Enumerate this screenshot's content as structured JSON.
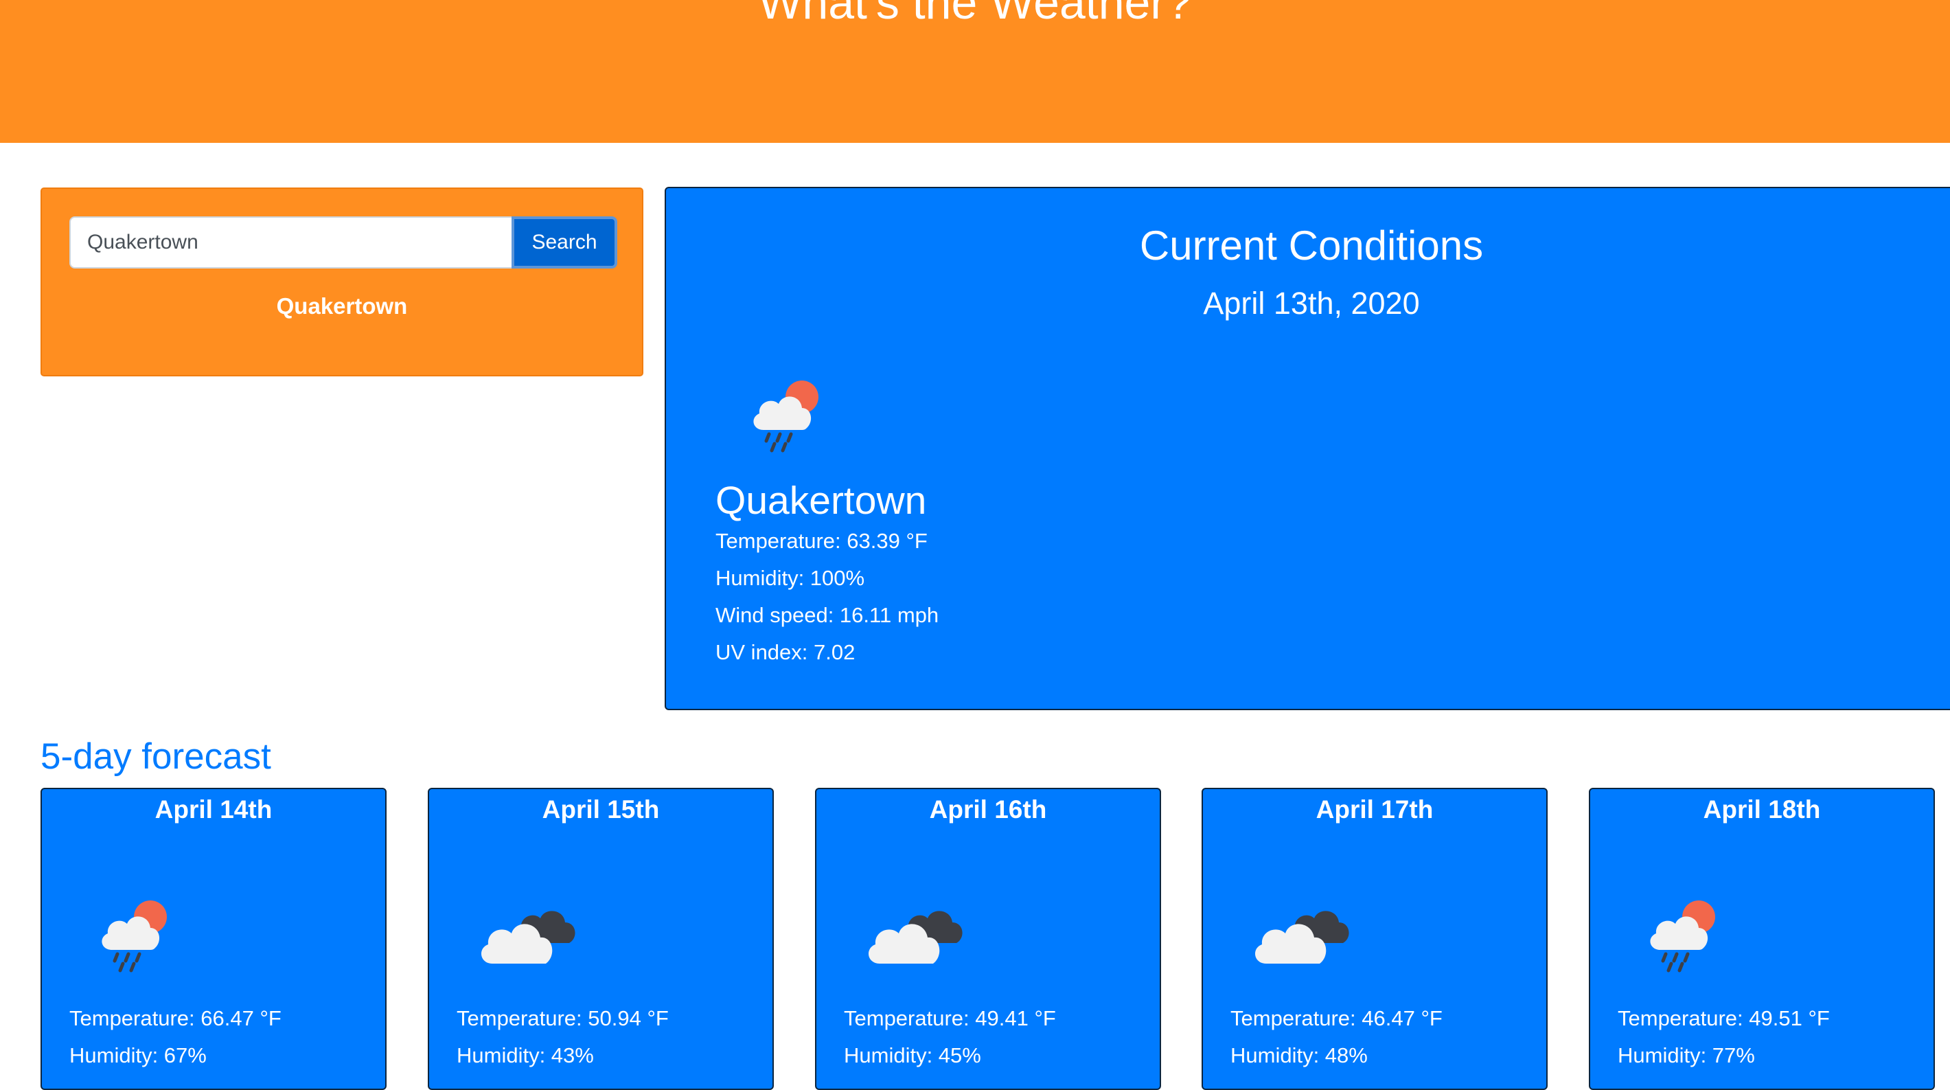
{
  "header": {
    "title": "What's the Weather?"
  },
  "search": {
    "input_value": "Quakertown",
    "button_label": "Search",
    "history": [
      "Quakertown"
    ]
  },
  "current": {
    "title": "Current Conditions",
    "date": "April 13th, 2020",
    "icon": "cloud-rain-sun-icon",
    "city": "Quakertown",
    "temperature": "Temperature: 63.39 °F",
    "humidity": "Humidity: 100%",
    "wind": "Wind speed: 16.11 mph",
    "uv": "UV index: 7.02"
  },
  "forecast": {
    "heading": "5-day forecast",
    "days": [
      {
        "date": "April 14th",
        "icon": "cloud-rain-sun-icon",
        "temperature": "Temperature: 66.47 °F",
        "humidity": "Humidity: 67%"
      },
      {
        "date": "April 15th",
        "icon": "broken-clouds-icon",
        "temperature": "Temperature: 50.94 °F",
        "humidity": "Humidity: 43%"
      },
      {
        "date": "April 16th",
        "icon": "broken-clouds-icon",
        "temperature": "Temperature: 49.41 °F",
        "humidity": "Humidity: 45%"
      },
      {
        "date": "April 17th",
        "icon": "broken-clouds-icon",
        "temperature": "Temperature: 46.47 °F",
        "humidity": "Humidity: 48%"
      },
      {
        "date": "April 18th",
        "icon": "cloud-rain-sun-icon",
        "temperature": "Temperature: 49.51 °F",
        "humidity": "Humidity: 77%"
      }
    ]
  },
  "colors": {
    "header_orange": "#ff8e20",
    "card_blue": "#007bff",
    "button_blue": "#0065d1",
    "sun": "#f2674b",
    "dark_cloud": "#3d3f45",
    "light_cloud": "#f2f2f2"
  }
}
